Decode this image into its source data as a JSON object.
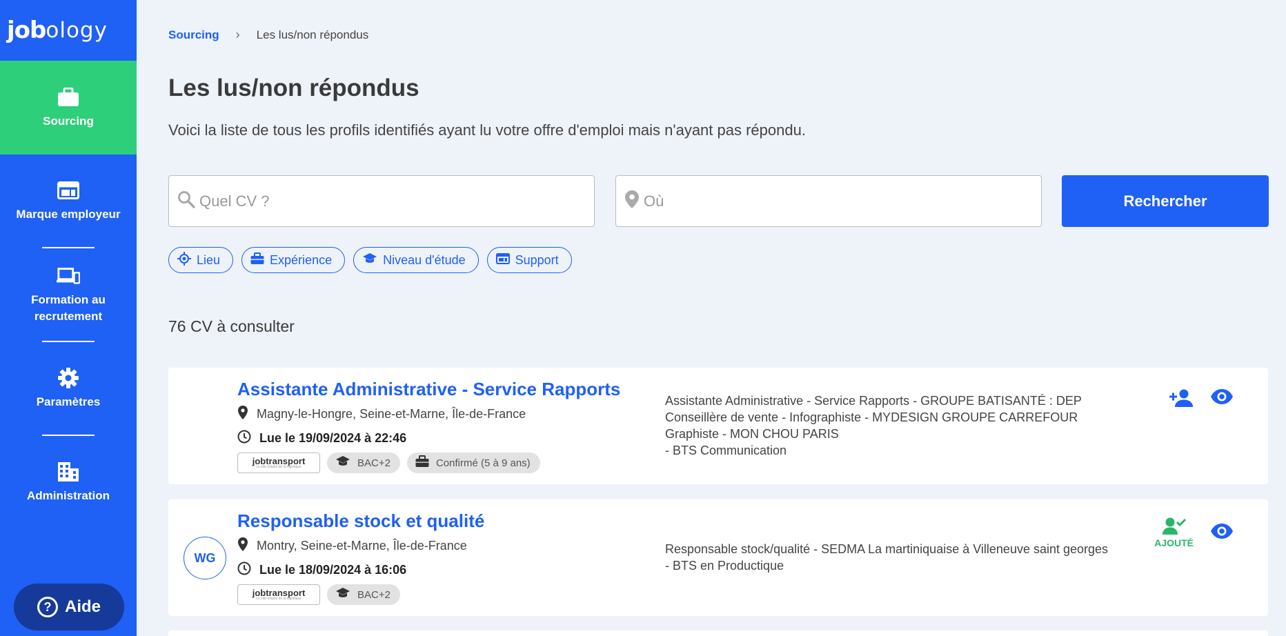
{
  "brand": {
    "logo_bold": "job",
    "logo_thin": "ology"
  },
  "sidebar": {
    "items": [
      {
        "label": "Sourcing",
        "icon": "briefcase-icon",
        "active": true
      },
      {
        "label": "Marque employeur",
        "icon": "browser-window-icon"
      },
      {
        "label": "Formation au recrutement",
        "icon": "devices-icon"
      },
      {
        "label": "Paramètres",
        "icon": "gear-icon"
      },
      {
        "label": "Administration",
        "icon": "building-icon"
      }
    ],
    "help_label": "Aide"
  },
  "breadcrumb": {
    "root": "Sourcing",
    "current": "Les lus/non répondus"
  },
  "page": {
    "title": "Les lus/non répondus",
    "subtitle": "Voici la liste de tous les profils identifiés ayant lu votre offre d'emploi mais n'ayant pas répondu."
  },
  "search": {
    "what_placeholder": "Quel CV ?",
    "where_placeholder": "Où",
    "button_label": "Rechercher"
  },
  "filters": [
    "Lieu",
    "Expérience",
    "Niveau d'étude",
    "Support"
  ],
  "results_count": "76 CV à consulter",
  "colors": {
    "primary": "#1f60f5",
    "active_nav": "#2ecf7a",
    "added": "#2bb56a"
  },
  "cards": [
    {
      "initials": "",
      "title": "Assistante Administrative - Service Rapports",
      "location": "Magny-le-Hongre, Seine-et-Marne, Île-de-France",
      "read_date": "Lue le 19/09/2024 à 22:46",
      "source_logo": "jobtransport",
      "source_tagline": "Le site emploi de la logistique",
      "tags": [
        "BAC+2",
        "Confirmé (5 à 9 ans)"
      ],
      "desc_lines": [
        "Assistante Administrative - Service Rapports - GROUPE BATISANTÉ : DEP",
        "Conseillère de vente - Infographiste - MYDESIGN GROUPE CARREFOUR",
        "Graphiste - MON CHOU PARIS",
        "- BTS Communication"
      ],
      "added": false,
      "added_label": ""
    },
    {
      "initials": "WG",
      "title": "Responsable stock et qualité",
      "location": "Montry, Seine-et-Marne, Île-de-France",
      "read_date": "Lue le 18/09/2024 à 16:06",
      "source_logo": "jobtransport",
      "source_tagline": "Le site emploi de la logistique",
      "tags": [
        "BAC+2"
      ],
      "desc_lines": [
        "Responsable stock/qualité - SEDMA La martiniquaise à Villeneuve saint georges",
        "- BTS en Productique"
      ],
      "added": true,
      "added_label": "AJOUTÉ"
    }
  ]
}
